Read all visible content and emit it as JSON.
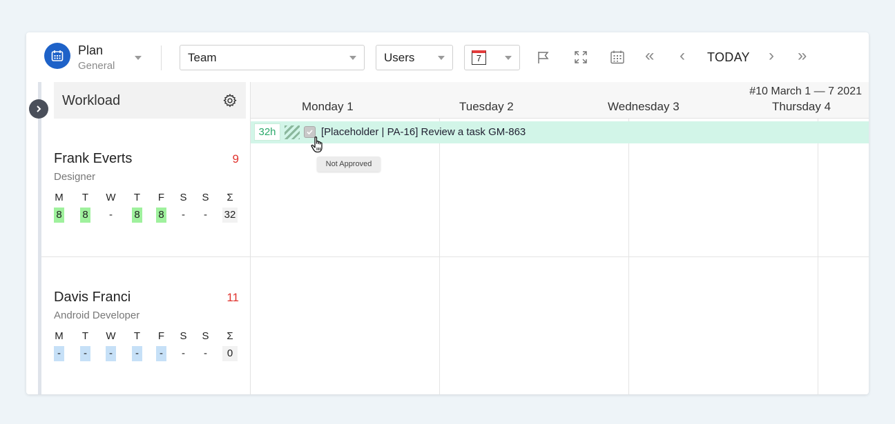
{
  "toolbar": {
    "plan_title": "Plan",
    "plan_subtitle": "General",
    "team_select": "Team",
    "users_select": "Users",
    "calendar_day": "7",
    "today_label": "TODAY",
    "icons": [
      "calendar-icon",
      "flag-icon",
      "fullscreen-icon",
      "grid-calendar-icon",
      "double-chevron-left-icon",
      "chevron-left-icon",
      "chevron-right-icon",
      "double-chevron-right-icon"
    ]
  },
  "sidebar": {
    "title": "Workload",
    "people": [
      {
        "name": "Frank Everts",
        "role": "Designer",
        "count": "9",
        "count_color": "#e0332e",
        "days": [
          "M",
          "T",
          "W",
          "T",
          "F",
          "S",
          "S",
          "Σ"
        ],
        "values": [
          "8",
          "8",
          "-",
          "8",
          "8",
          "-",
          "-",
          "32"
        ]
      },
      {
        "name": "Davis Franci",
        "role": "Android Developer",
        "count": "11",
        "count_color": "#e0332e",
        "days": [
          "M",
          "T",
          "W",
          "T",
          "F",
          "S",
          "S",
          "Σ"
        ],
        "values": [
          "-",
          "-",
          "-",
          "-",
          "-",
          "-",
          "-",
          "0"
        ]
      }
    ]
  },
  "calendar": {
    "week_label": "#10 March 1 — 7 2021",
    "days": [
      "Monday 1",
      "Tuesday 2",
      "Wednesday 3",
      "Thursday 4"
    ]
  },
  "task": {
    "hours": "32h",
    "title": "[Placeholder | PA-16] Review a task GM-863",
    "tooltip": "Not Approved",
    "bar_color": "#d2f5e8"
  }
}
